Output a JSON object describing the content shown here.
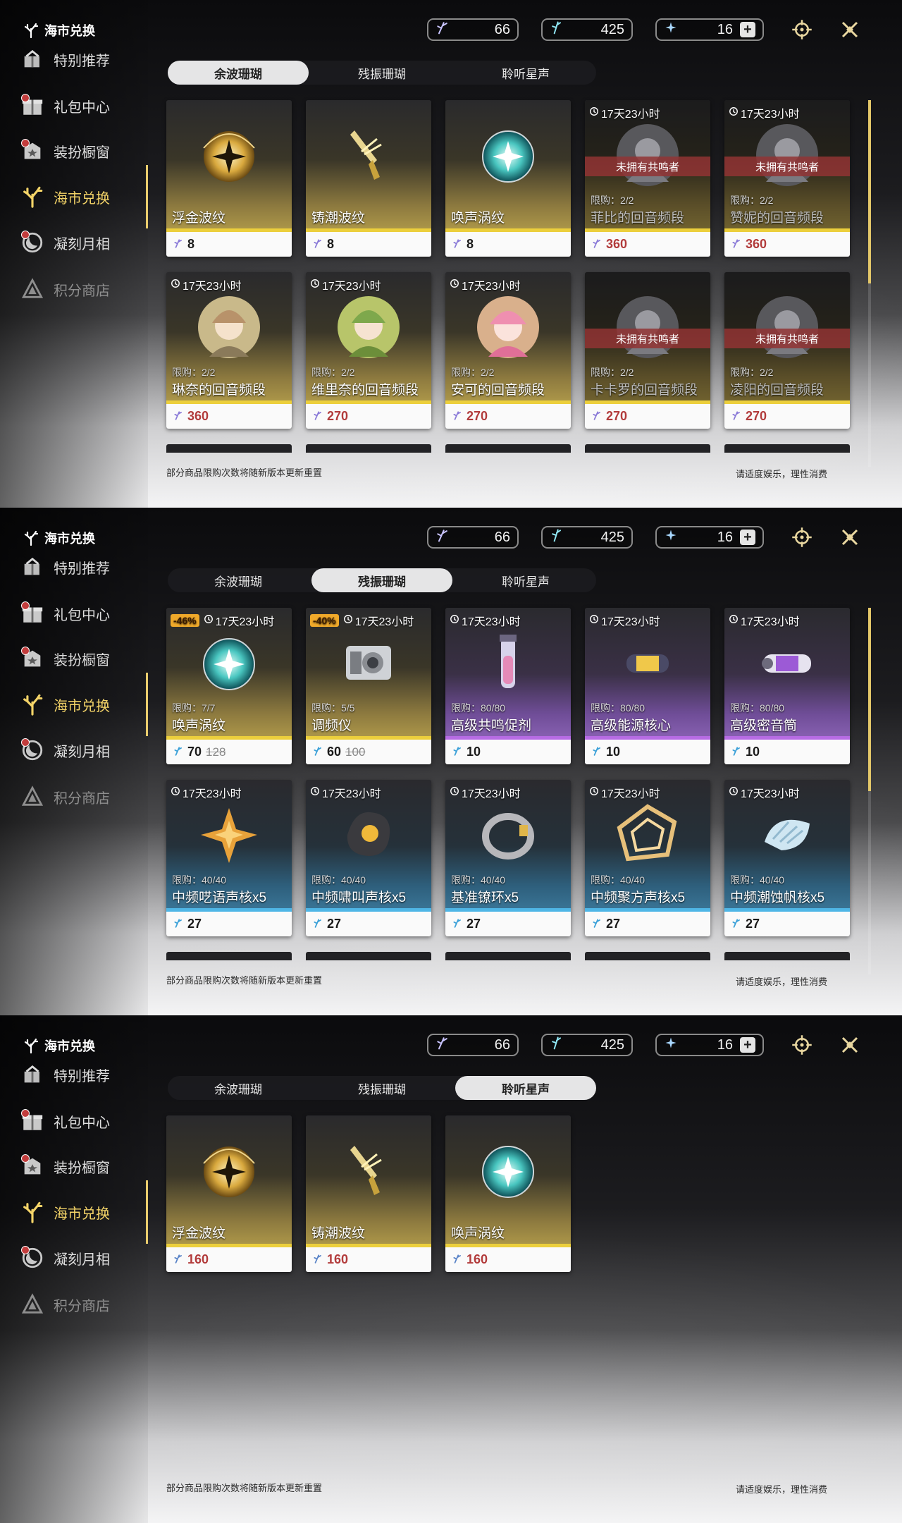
{
  "app": {
    "title": "海市兑换"
  },
  "sidebar": {
    "items": [
      {
        "label": "特别推荐",
        "icon": "gift-box-icon"
      },
      {
        "label": "礼包中心",
        "icon": "gift-icon"
      },
      {
        "label": "装扮橱窗",
        "icon": "outfit-icon"
      },
      {
        "label": "海市兑换",
        "icon": "coral-icon"
      },
      {
        "label": "凝刻月相",
        "icon": "moon-icon"
      },
      {
        "label": "积分商店",
        "icon": "triangle-icon"
      }
    ]
  },
  "currencies": [
    {
      "icon": "coral-wave-icon",
      "value": "66"
    },
    {
      "icon": "resonance-coral-icon",
      "value": "425"
    },
    {
      "icon": "star-sound-icon",
      "value": "16"
    }
  ],
  "tabs": [
    "余波珊瑚",
    "残振珊瑚",
    "聆听星声"
  ],
  "footer": {
    "left": "部分商品限购次数将随新版本更新重置",
    "right": "请适度娱乐，理性消费"
  },
  "screens": [
    {
      "selected_tab": 0,
      "cards": [
        {
          "name": "浮金波纹",
          "price": "8",
          "color": "gold",
          "pic": "gold-orb"
        },
        {
          "name": "铸潮波纹",
          "price": "8",
          "color": "gold",
          "pic": "sword"
        },
        {
          "name": "唤声涡纹",
          "price": "8",
          "color": "gold",
          "pic": "teal-orb"
        },
        {
          "name": "菲比的回音频段",
          "price": "360",
          "color": "gold",
          "timer": "17天23小时",
          "limit": "限购：2/2",
          "owner": "未拥有共鸣者",
          "locked": true,
          "pic": "portrait-gray"
        },
        {
          "name": "赞妮的回音频段",
          "price": "360",
          "color": "gold",
          "timer": "17天23小时",
          "limit": "限购：2/2",
          "owner": "未拥有共鸣者",
          "locked": true,
          "pic": "portrait-gray"
        },
        {
          "name": "琳奈的回音频段",
          "price": "360",
          "color": "gold",
          "timer": "17天23小时",
          "limit": "限购：2/2",
          "pic": "portrait-beige"
        },
        {
          "name": "维里奈的回音频段",
          "price": "270",
          "color": "gold",
          "timer": "17天23小时",
          "limit": "限购：2/2",
          "pic": "portrait-green"
        },
        {
          "name": "安可的回音频段",
          "price": "270",
          "color": "gold",
          "timer": "17天23小时",
          "limit": "限购：2/2",
          "pic": "portrait-pink"
        },
        {
          "name": "卡卡罗的回音频段",
          "price": "270",
          "color": "gold",
          "timer": "",
          "limit": "限购：2/2",
          "owner": "未拥有共鸣者",
          "locked": true,
          "pic": "portrait-gray"
        },
        {
          "name": "凌阳的回音频段",
          "price": "270",
          "color": "gold",
          "timer": "",
          "limit": "限购：2/2",
          "owner": "未拥有共鸣者",
          "locked": true,
          "pic": "portrait-gray"
        }
      ]
    },
    {
      "selected_tab": 1,
      "cards": [
        {
          "name": "唤声涡纹",
          "price": "70",
          "old_price": "128",
          "color": "gold",
          "discount": "-46%",
          "timer": "17天23小时",
          "limit": "限购：7/7",
          "pic": "teal-orb"
        },
        {
          "name": "调频仪",
          "price": "60",
          "old_price": "100",
          "color": "gold",
          "discount": "-40%",
          "timer": "17天23小时",
          "limit": "限购：5/5",
          "pic": "device"
        },
        {
          "name": "高级共鸣促剂",
          "price": "10",
          "color": "purple",
          "timer": "17天23小时",
          "limit": "限购：80/80",
          "pic": "vial"
        },
        {
          "name": "高级能源核心",
          "price": "10",
          "color": "purple",
          "timer": "17天23小时",
          "limit": "限购：80/80",
          "pic": "capsule"
        },
        {
          "name": "高级密音筒",
          "price": "10",
          "color": "purple",
          "timer": "17天23小时",
          "limit": "限购：80/80",
          "pic": "cylinder"
        },
        {
          "name": "中频呓语声核x5",
          "price": "27",
          "color": "blue",
          "timer": "17天23小时",
          "limit": "限购：40/40",
          "pic": "star-shard"
        },
        {
          "name": "中频啸叫声核x5",
          "price": "27",
          "color": "blue",
          "timer": "17天23小时",
          "limit": "限购：40/40",
          "pic": "dark-core"
        },
        {
          "name": "基准镣环x5",
          "price": "27",
          "color": "blue",
          "timer": "17天23小时",
          "limit": "限购：40/40",
          "pic": "ring"
        },
        {
          "name": "中频聚方声核x5",
          "price": "27",
          "color": "blue",
          "timer": "17天23小时",
          "limit": "限购：40/40",
          "pic": "golden-frame"
        },
        {
          "name": "中频潮蚀帆核x5",
          "price": "27",
          "color": "blue",
          "timer": "17天23小时",
          "limit": "限购：40/40",
          "pic": "shell"
        }
      ]
    },
    {
      "selected_tab": 2,
      "cards": [
        {
          "name": "浮金波纹",
          "price": "160",
          "color": "gold",
          "pic": "gold-orb",
          "red": true
        },
        {
          "name": "铸潮波纹",
          "price": "160",
          "color": "gold",
          "pic": "sword",
          "red": true
        },
        {
          "name": "唤声涡纹",
          "price": "160",
          "color": "gold",
          "pic": "teal-orb",
          "red": true
        }
      ]
    }
  ]
}
